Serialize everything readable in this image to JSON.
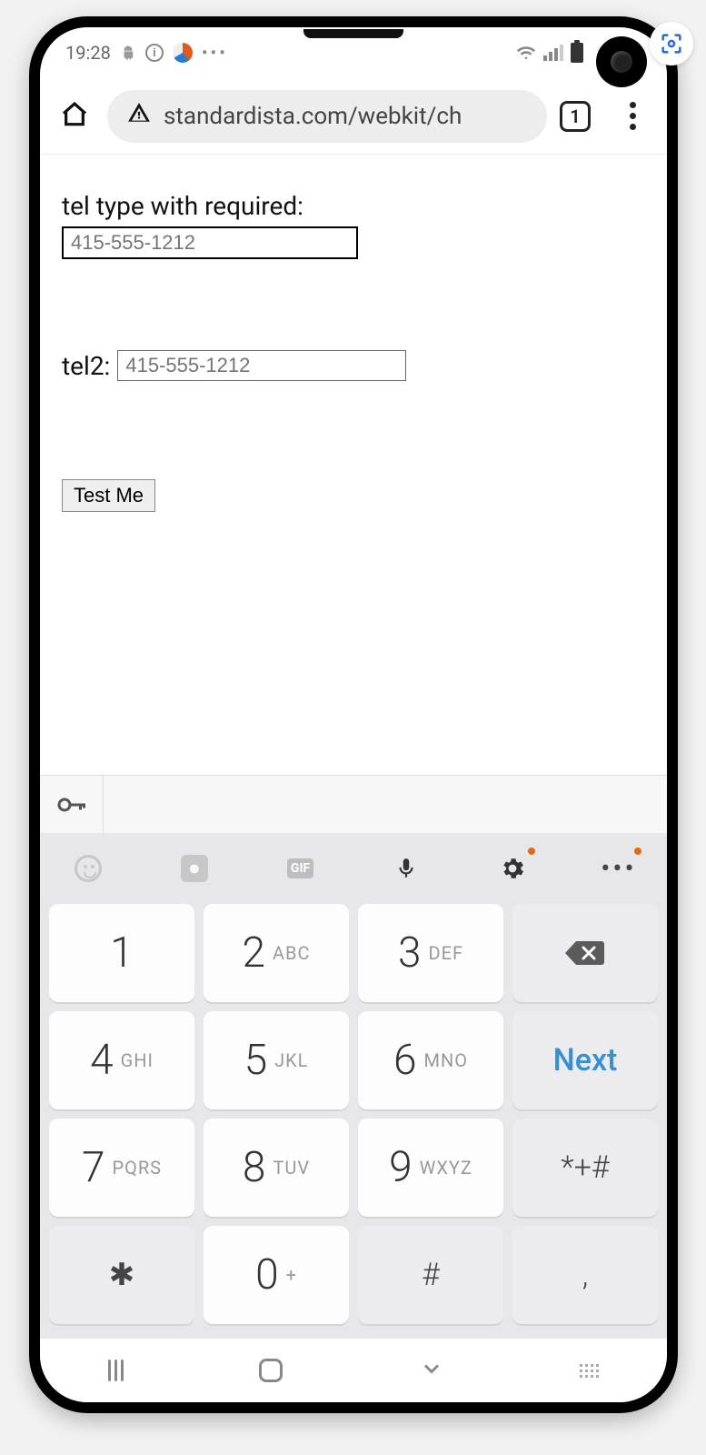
{
  "statusbar": {
    "time": "19:28"
  },
  "browser": {
    "url": "standardista.com/webkit/ch",
    "tab_count": "1"
  },
  "page": {
    "label1": "tel type with required:",
    "placeholder1": "415-555-1212",
    "label2": "tel2:",
    "placeholder2": "415-555-1212",
    "button": "Test Me"
  },
  "keyboard": {
    "rows": [
      [
        {
          "n": "1",
          "l": ""
        },
        {
          "n": "2",
          "l": "ABC"
        },
        {
          "n": "3",
          "l": "DEF"
        },
        {
          "type": "backspace"
        }
      ],
      [
        {
          "n": "4",
          "l": "GHI"
        },
        {
          "n": "5",
          "l": "JKL"
        },
        {
          "n": "6",
          "l": "MNO"
        },
        {
          "type": "next",
          "label": "Next"
        }
      ],
      [
        {
          "n": "7",
          "l": "PQRS"
        },
        {
          "n": "8",
          "l": "TUV"
        },
        {
          "n": "9",
          "l": "WXYZ"
        },
        {
          "type": "sym",
          "label": "*+#"
        }
      ],
      [
        {
          "type": "sym",
          "label": "✱"
        },
        {
          "n": "0",
          "l": "+"
        },
        {
          "type": "sym",
          "label": "#"
        },
        {
          "type": "sym",
          "label": ","
        }
      ]
    ]
  }
}
